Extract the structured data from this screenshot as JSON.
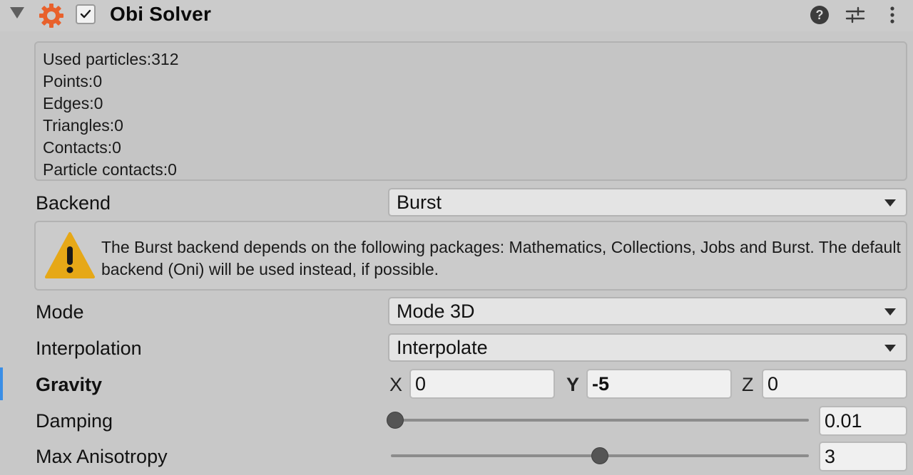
{
  "header": {
    "title": "Obi Solver",
    "enabled": true
  },
  "info": {
    "lines": [
      "Used particles:312",
      "Points:0",
      "Edges:0",
      "Triangles:0",
      "Contacts:0",
      "Particle contacts:0"
    ]
  },
  "backend": {
    "label": "Backend",
    "value": "Burst"
  },
  "warning": {
    "text": "The Burst backend depends on the following packages: Mathematics, Collections, Jobs and Burst. The default backend (Oni) will be used instead, if possible."
  },
  "mode": {
    "label": "Mode",
    "value": "Mode 3D"
  },
  "interpolation": {
    "label": "Interpolation",
    "value": "Interpolate"
  },
  "gravity": {
    "label": "Gravity",
    "x_label": "X",
    "x": "0",
    "y_label": "Y",
    "y": "-5",
    "z_label": "Z",
    "z": "0"
  },
  "damping": {
    "label": "Damping",
    "value": "0.01",
    "slider_fraction": 0.01
  },
  "max_anisotropy": {
    "label": "Max Anisotropy",
    "value": "3",
    "slider_fraction": 0.5
  },
  "colors": {
    "gear": "#e8612c",
    "warning": "#e6a817",
    "focus": "#3a8ee6"
  },
  "icons": {
    "component": "gear-icon",
    "help": "help-icon",
    "presets": "sliders-icon",
    "more": "more-vertical-icon",
    "warning": "warning-icon"
  }
}
